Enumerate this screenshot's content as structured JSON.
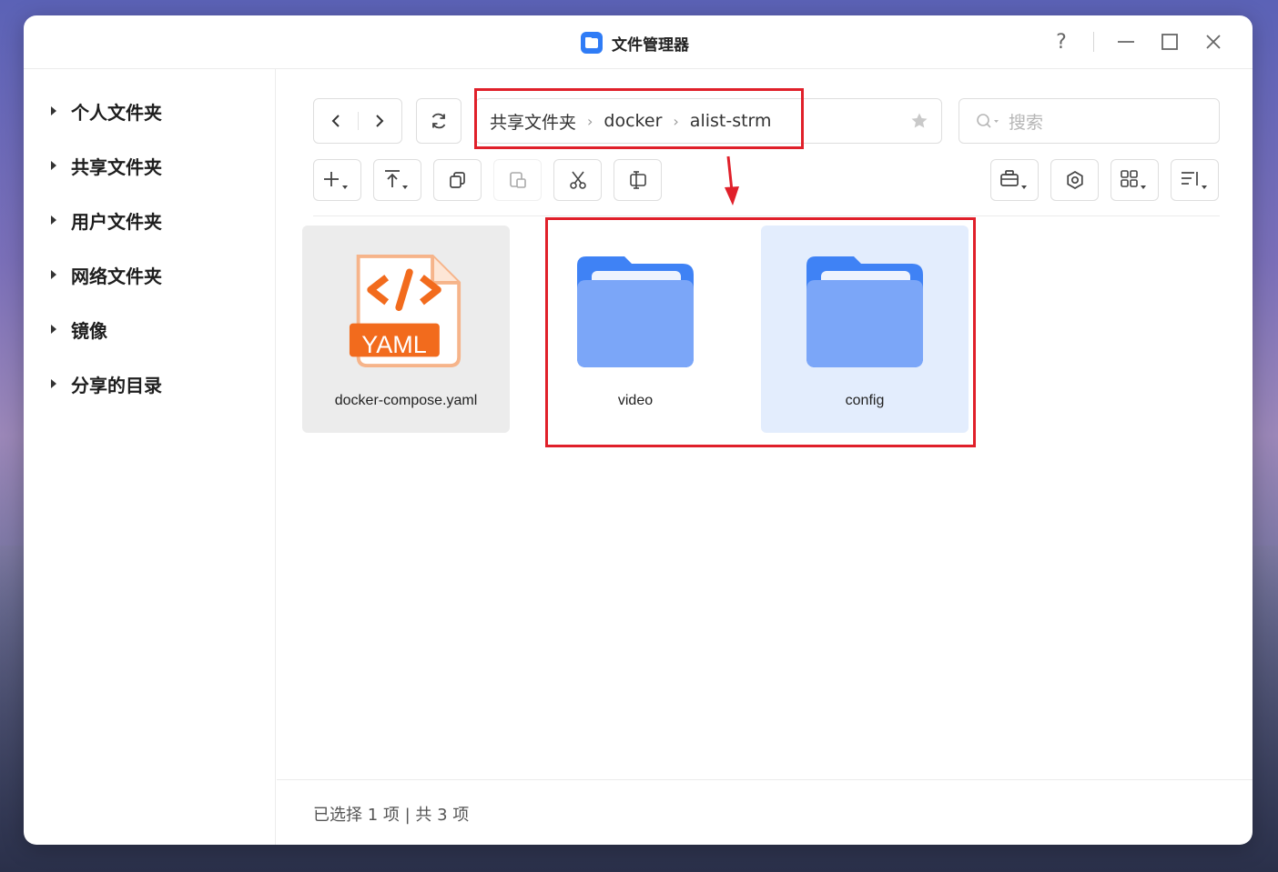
{
  "window": {
    "title": "文件管理器"
  },
  "controls": {
    "help": "?"
  },
  "sidebar": {
    "items": [
      {
        "label": "个人文件夹"
      },
      {
        "label": "共享文件夹"
      },
      {
        "label": "用户文件夹"
      },
      {
        "label": "网络文件夹"
      },
      {
        "label": "镜像"
      },
      {
        "label": "分享的目录"
      }
    ]
  },
  "path": {
    "crumbs": [
      "共享文件夹",
      "docker",
      "alist-strm"
    ],
    "separator": "›"
  },
  "search": {
    "placeholder": "搜索"
  },
  "files": [
    {
      "name": "docker-compose.yaml",
      "type": "yaml",
      "badge": "YAML",
      "selected": true
    },
    {
      "name": "video",
      "type": "folder",
      "selected": false
    },
    {
      "name": "config",
      "type": "folder",
      "selected": false,
      "hovered": true
    }
  ],
  "footer": {
    "status": "已选择 1 项 | 共 3 项"
  },
  "colors": {
    "accent": "#2f7cf6",
    "folder": "#6f9cf7",
    "yaml": "#f26b1d",
    "annotation": "#e0202a",
    "selected_bg": "#ececec",
    "hover_bg": "#e3edfd"
  }
}
